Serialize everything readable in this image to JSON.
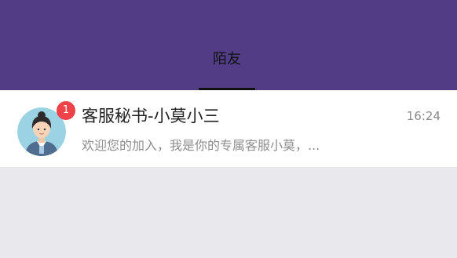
{
  "header": {
    "background": "#513c85",
    "active_tab": {
      "label": "陌友"
    }
  },
  "conversations": [
    {
      "title": "客服秘书-小莫小三",
      "preview": "欢迎您的加入，我是你的专属客服小莫，...",
      "time": "16:24",
      "unread_count": "1",
      "avatar_icon": "customer-service-agent-avatar"
    }
  ],
  "colors": {
    "badge": "#ef4249",
    "page_background": "#e9e8ed",
    "row_background": "#ffffff"
  }
}
